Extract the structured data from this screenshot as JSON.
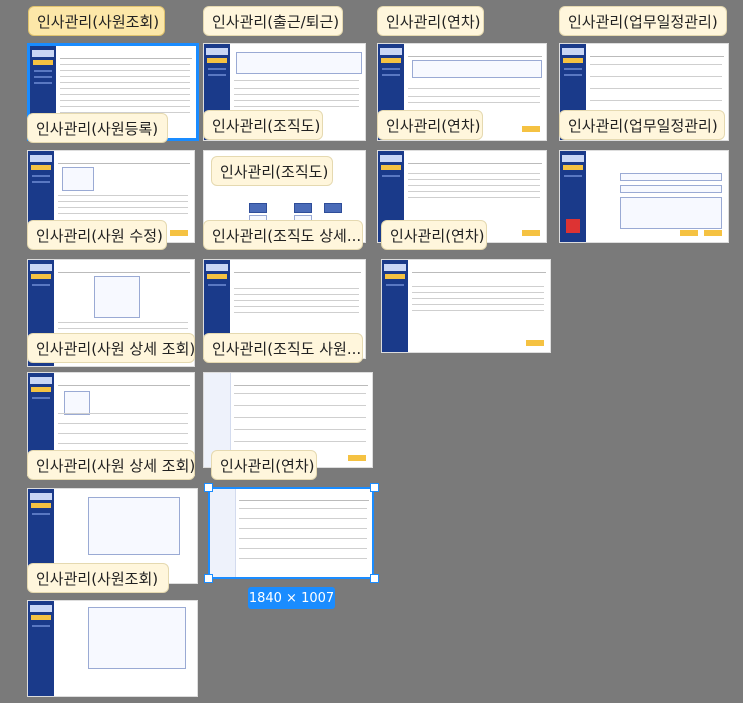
{
  "columns": [
    {
      "label": "인사관리(사원조회)",
      "active": true
    },
    {
      "label": "인사관리(출근/퇴근)",
      "active": false
    },
    {
      "label": "인사관리(연차)",
      "active": false
    },
    {
      "label": "인사관리(업무일정관리)",
      "active": false
    }
  ],
  "frame_labels": [
    "인사관리(사원등록)",
    "인사관리(조직도)",
    "인사관리(연차)",
    "인사관리(업무일정관리)",
    "인사관리(조직도)",
    "인사관리(사원 수정)",
    "인사관리(조직도 상세...",
    "인사관리(연차)",
    "인사관리(사원 상세 조회)",
    "인사관리(조직도 사원...",
    "인사관리(사원 상세 조회)",
    "인사관리(연차)",
    "인사관리(사원조회)"
  ],
  "selection": {
    "size_label": "1840 × 1007"
  },
  "colors": {
    "canvas": "#7a7a7a",
    "label_bg": "#fff6dc",
    "label_active_bg": "#fce7a8",
    "selection": "#1a8cff",
    "sidebar": "#1a3a8a",
    "accent": "#f5c242"
  }
}
